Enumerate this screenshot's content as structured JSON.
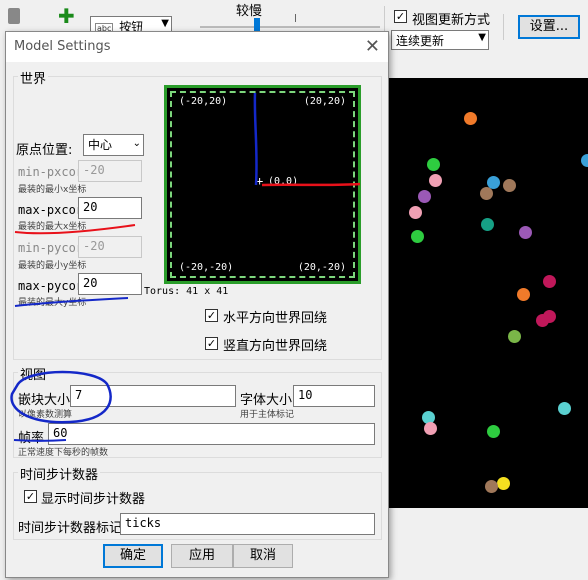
{
  "toolbar": {
    "add_icon": "plus-icon",
    "widget_type_icon": "abc",
    "widget_type_value": "按钮",
    "speed_label": "较慢",
    "view_update_checkbox_label": "视图更新方式",
    "view_update_checked": true,
    "view_update_mode": "连续更新",
    "settings_button": "设置..."
  },
  "dialog": {
    "title": "Model Settings",
    "world": {
      "title": "世界",
      "origin_label": "原点位置:",
      "origin_value": "中心",
      "min_pxcor_label": "min-pxcor",
      "min_pxcor_value": "-20",
      "min_pxcor_hint": "最装的最小x坐标",
      "max_pxcor_label": "max-pxcor",
      "max_pxcor_value": "20",
      "max_pxcor_hint": "最装的最大x坐标",
      "min_pycor_label": "min-pycor",
      "min_pycor_value": "-20",
      "min_pycor_hint": "最装的最小y坐标",
      "max_pycor_label": "max-pycor",
      "max_pycor_value": "20",
      "max_pycor_hint": "最装的最大y坐标",
      "corner_tl": "(-20,20)",
      "corner_tr": "(20,20)",
      "corner_bl": "(-20,-20)",
      "corner_br": "(20,-20)",
      "origin_marker": "(0,0)",
      "topology": "Torus: 41 x 41",
      "wrap_horizontal_label": "水平方向世界回绕",
      "wrap_horizontal_checked": true,
      "wrap_vertical_label": "竖直方向世界回绕",
      "wrap_vertical_checked": true
    },
    "view": {
      "title": "视图",
      "patch_size_label": "嵌块大小",
      "patch_size_value": "7",
      "patch_size_hint": "以像素数测算",
      "font_size_label": "字体大小",
      "font_size_value": "10",
      "font_size_hint": "用于主体标记",
      "frame_rate_label": "帧率",
      "frame_rate_value": "60",
      "frame_rate_hint": "正常速度下每秒的帧数"
    },
    "tick_counter": {
      "title": "时间步计数器",
      "show_label": "显示时间步计数器",
      "show_checked": true,
      "counter_label_label": "时间步计数器标记",
      "counter_label_value": "ticks"
    },
    "buttons": {
      "ok": "确定",
      "apply": "应用",
      "cancel": "取消"
    }
  },
  "turtle_colors": [
    "#f07a2a",
    "#2ecc40",
    "#f0a0b4",
    "#9b59b6",
    "#3aa0d8",
    "#a0785a",
    "#16a085",
    "#c0185a",
    "#7ab648",
    "#5ad0d0",
    "#f5e020"
  ],
  "annotation_colors": {
    "red": "#e8111a",
    "blue": "#1428c8"
  }
}
